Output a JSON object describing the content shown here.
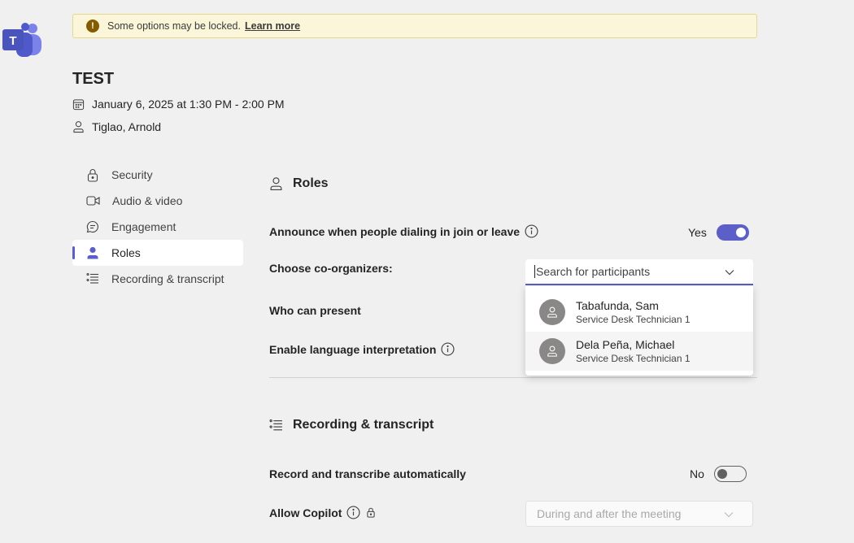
{
  "app": {
    "logo_letter": "T"
  },
  "banner": {
    "message": "Some options may be locked.",
    "link": "Learn more"
  },
  "meeting": {
    "title": "TEST",
    "datetime": "January 6, 2025 at 1:30 PM - 2:00 PM",
    "organizer": "Tiglao, Arnold"
  },
  "sidebar": {
    "items": [
      {
        "label": "Security",
        "icon": "lock-icon"
      },
      {
        "label": "Audio & video",
        "icon": "video-icon"
      },
      {
        "label": "Engagement",
        "icon": "chat-icon"
      },
      {
        "label": "Roles",
        "icon": "person-icon",
        "active": true
      },
      {
        "label": "Recording & transcript",
        "icon": "list-icon"
      }
    ]
  },
  "roles": {
    "heading": "Roles",
    "announce_label": "Announce when people dialing in join or leave",
    "announce_value": "Yes",
    "coorganizers_label": "Choose co-organizers:",
    "search_placeholder": "Search for participants",
    "who_can_present_label": "Who can present",
    "language_interpretation_label": "Enable language interpretation",
    "suggestions": [
      {
        "name": "Tabafunda, Sam",
        "title": "Service Desk Technician 1"
      },
      {
        "name": "Dela Peña, Michael",
        "title": "Service Desk Technician 1"
      }
    ]
  },
  "recording": {
    "heading": "Recording & transcript",
    "auto_label": "Record and transcribe automatically",
    "auto_value": "No",
    "copilot_label": "Allow Copilot",
    "copilot_value": "During and after the meeting"
  },
  "colors": {
    "accent": "#5b5fc7",
    "banner_bg": "#fbf6d9",
    "background": "#f0f0f0"
  }
}
